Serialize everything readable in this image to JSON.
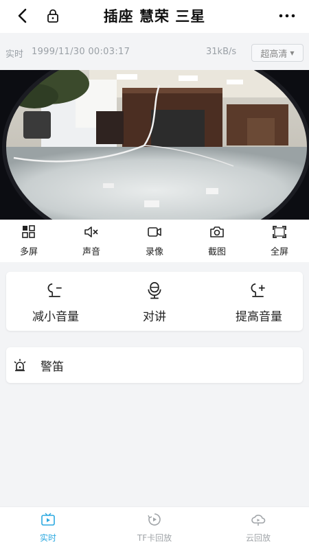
{
  "header": {
    "title": "插座 慧荣 三星",
    "back_icon": "back-arrow-icon",
    "lock_icon": "lock-icon",
    "more_icon": "more-dots-icon"
  },
  "info": {
    "mode": "实时",
    "datetime": "1999/11/30 00:03:17",
    "speed": "31kB/s",
    "quality": "超高清"
  },
  "controls": [
    {
      "label": "多屏",
      "icon": "multi-screen-icon"
    },
    {
      "label": "声音",
      "icon": "sound-mute-icon"
    },
    {
      "label": "录像",
      "icon": "video-record-icon"
    },
    {
      "label": "截图",
      "icon": "camera-icon"
    },
    {
      "label": "全屏",
      "icon": "fullscreen-icon"
    }
  ],
  "talk": {
    "volume_down": "减小音量",
    "intercom": "对讲",
    "volume_up": "提高音量"
  },
  "alarm": {
    "label": "警笛",
    "icon": "siren-icon"
  },
  "tabs": [
    {
      "label": "实时",
      "icon": "live-tv-icon",
      "active": true
    },
    {
      "label": "TF卡回放",
      "icon": "playback-icon",
      "active": false
    },
    {
      "label": "云回放",
      "icon": "cloud-playback-icon",
      "active": false
    }
  ],
  "colors": {
    "accent": "#2aa8e0",
    "background": "#f3f4f6",
    "text": "#222222",
    "muted": "#9aa0a6"
  }
}
